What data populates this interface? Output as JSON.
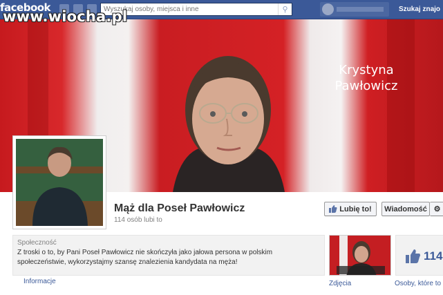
{
  "watermark": "www.wiocha.pl",
  "topbar": {
    "logo": "facebook",
    "search_placeholder": "Wyszukaj osoby, miejsca i inne",
    "find_friends": "Szukaj znajo",
    "icons": [
      "friend-requests-icon",
      "messages-icon",
      "notifications-icon",
      "search-icon"
    ]
  },
  "cover": {
    "caption_line1": "Krystyna",
    "caption_line2": "Pawłowicz"
  },
  "page": {
    "name": "Mąż dla Poseł Pawłowicz",
    "likes": "114 osób lubi to",
    "like_button": "Lubię to!",
    "message_button": "Wiadomość",
    "gear_icon": "gear-icon"
  },
  "about": {
    "category": "Społeczność",
    "description": "Z troski o to, by Pani Poseł Pawłowicz nie skończyła jako jałowa persona w polskim społeczeństwie, wykorzystajmy szansę znalezienia kandydata na męża!",
    "info_link": "Informacje"
  },
  "apps": {
    "photos_label": "Zdjęcia",
    "likes_number": "114",
    "people_label": "Osoby, które to"
  },
  "colors": {
    "facebook_blue": "#3b5998",
    "flag_red": "#d42125"
  }
}
